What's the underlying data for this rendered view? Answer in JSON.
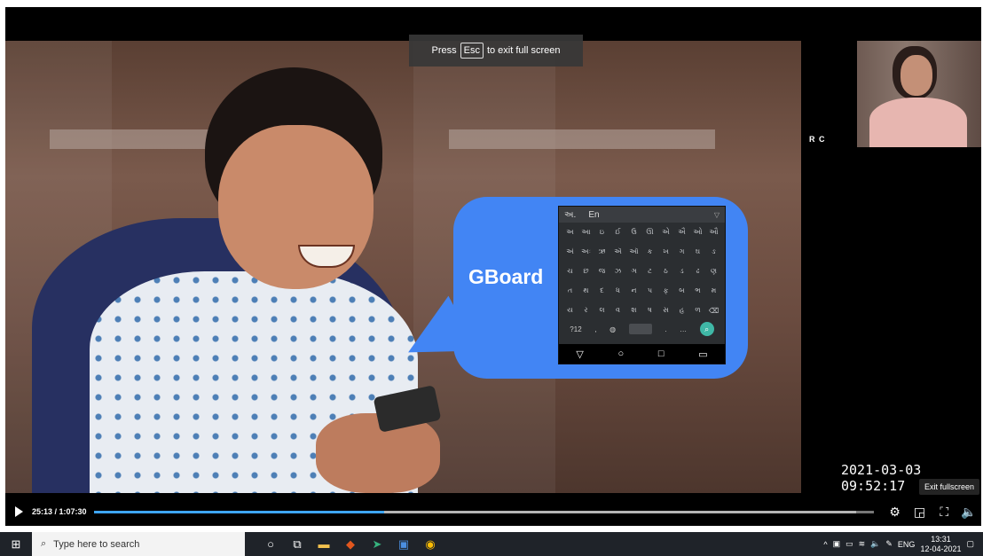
{
  "banner": {
    "press": "Press",
    "key": "Esc",
    "rest": "to exit full screen"
  },
  "slide": {
    "callout_label": "GBoard",
    "keyboard": {
      "top_left": "અ.",
      "top_lang": "En",
      "rows": [
        [
          "અ",
          "આ",
          "ઇ",
          "ઈ",
          "ઉ",
          "ઊ",
          "એ",
          "ઐ",
          "ઓ",
          "ઔ"
        ],
        [
          "અં",
          "અઃ",
          "ઋ",
          "ઍ",
          "ઑ",
          "ક",
          "ખ",
          "ગ",
          "ઘ",
          "ઙ"
        ],
        [
          "ચ",
          "છ",
          "જ",
          "ઝ",
          "ઞ",
          "ટ",
          "ઠ",
          "ડ",
          "ઢ",
          "ણ"
        ],
        [
          "ત",
          "થ",
          "દ",
          "ધ",
          "ન",
          "પ",
          "ફ",
          "બ",
          "ભ",
          "મ"
        ],
        [
          "ય",
          "ર",
          "લ",
          "વ",
          "શ",
          "ષ",
          "સ",
          "હ",
          "ળ",
          "⌫"
        ]
      ],
      "bottom_left": "?12",
      "nav": [
        "▽",
        "○",
        "□",
        "▭"
      ]
    }
  },
  "participant": {
    "name": "R C"
  },
  "overlay": {
    "timestamp": "2021-03-03 09:52:17",
    "tooltip": "Exit fullscreen"
  },
  "player": {
    "time": "25:13 / 1:07:30",
    "progress_fraction": 0.373,
    "buffered_fraction": 0.978,
    "icons": [
      "settings-icon",
      "miniplayer-icon",
      "exit-fullscreen-icon",
      "volume-icon"
    ]
  },
  "taskbar": {
    "search_placeholder": "Type here to search",
    "apps": [
      "cortana-icon",
      "task-view-icon",
      "file-explorer-icon",
      "office-icon",
      "app-icon",
      "app-icon-2",
      "chrome-icon"
    ],
    "lang": "ENG",
    "time": "13:31",
    "date": "12-04-2021"
  }
}
